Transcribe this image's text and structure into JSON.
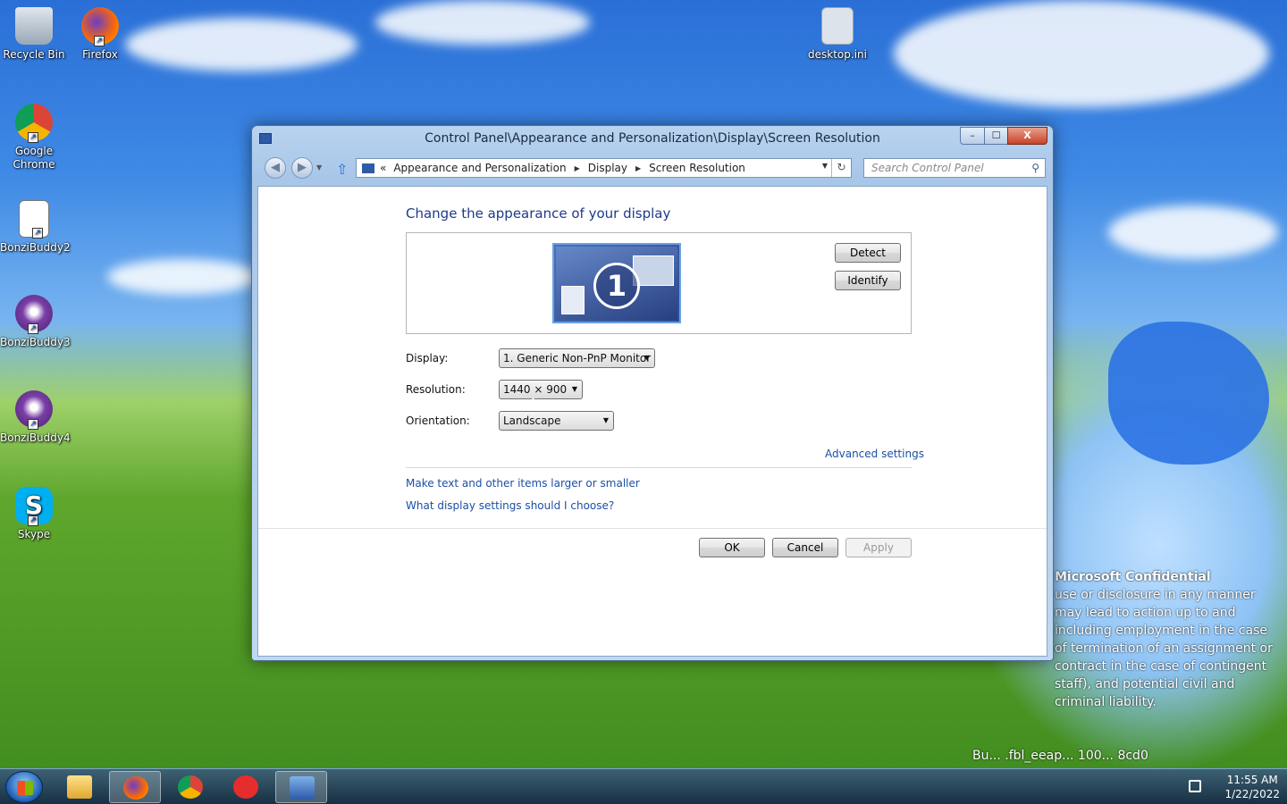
{
  "desktop": {
    "icons": [
      {
        "label": "Recycle Bin"
      },
      {
        "label": "Firefox"
      },
      {
        "label": "desktop.ini"
      },
      {
        "label": "Google Chrome"
      },
      {
        "label": "BonziBuddy2"
      },
      {
        "label": "BonziBuddy3"
      },
      {
        "label": "BonziBuddy4"
      },
      {
        "label": "Skype"
      }
    ],
    "watermark": {
      "title": "Microsoft Confidential",
      "body": "use or disclosure in any manner may lead to action up to and including employment in the case of termination of an assignment or contract in the case of contingent staff), and potential civil and criminal liability.",
      "build_fragment": "Bu... .fbl_eeap... 100... 8cd0"
    }
  },
  "window": {
    "title": "Control Panel\\Appearance and Personalization\\Display\\Screen Resolution",
    "controls": {
      "minimize": "–",
      "maximize": "☐",
      "close": "X"
    },
    "address": {
      "overflow": "«",
      "crumbs": [
        "Appearance and Personalization",
        "Display",
        "Screen Resolution"
      ]
    },
    "search_placeholder": "Search Control Panel",
    "heading": "Change the appearance of your display",
    "monitor_number": "1",
    "buttons": {
      "detect": "Detect",
      "identify": "Identify",
      "ok": "OK",
      "cancel": "Cancel",
      "apply": "Apply"
    },
    "fields": {
      "display_label": "Display:",
      "display_value": "1. Generic Non-PnP Monitor",
      "resolution_label": "Resolution:",
      "resolution_value": "1440 × 900",
      "orientation_label": "Orientation:",
      "orientation_value": "Landscape"
    },
    "links": {
      "advanced": "Advanced settings",
      "text_size": "Make text and other items larger or smaller",
      "which_settings": "What display settings should I choose?"
    }
  },
  "taskbar": {
    "clock_time": "11:55 AM",
    "clock_date": "1/22/2022"
  }
}
